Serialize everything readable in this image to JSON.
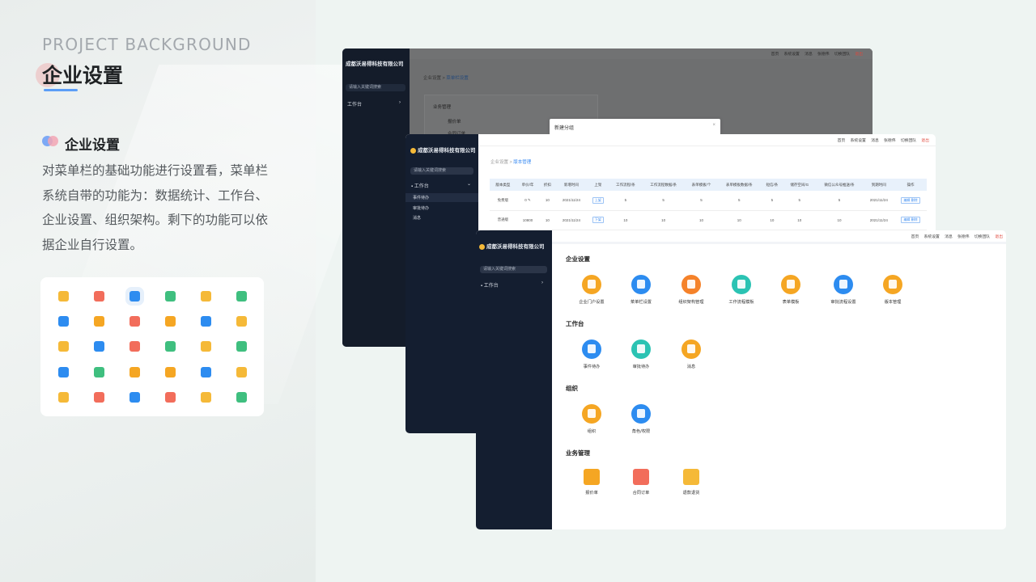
{
  "slide": {
    "kicker": "PROJECT  BACKGROUND",
    "title": "企业设置",
    "subtitle": "企业设置",
    "paragraph_lines": [
      "对菜单栏的基础功能进行设置看，菜单栏",
      "系统自带的功能为：数据统计、工作台、",
      "企业设置、组织架构。剩下的功能可以依",
      "据企业自行设置。"
    ]
  },
  "colors": {
    "accent_blue": "#3a8bf2",
    "underline": "#5b9ef7",
    "orange": "#f5a623",
    "blue": "#2d8cf0",
    "teal": "#2bc3b3",
    "salmon": "#f26d5b",
    "green": "#3fbf7f",
    "dark_sidebar": "#141e30",
    "logout_red": "#e0483c"
  },
  "icon_grid_colors": [
    [
      "#f5b938",
      "#f26d5b",
      "#2d8cf0",
      "#3fbf7f",
      "#f5b938",
      "#3fbf7f"
    ],
    [
      "#2d8cf0",
      "#f5a623",
      "#f26d5b",
      "#f5a623",
      "#2d8cf0",
      "#f5b938"
    ],
    [
      "#f5b938",
      "#2d8cf0",
      "#f26d5b",
      "#3fbf7f",
      "#f5b938",
      "#3fbf7f"
    ],
    [
      "#2d8cf0",
      "#3fbf7f",
      "#f5a623",
      "#f5a623",
      "#2d8cf0",
      "#f5b938"
    ],
    [
      "#f5b938",
      "#f26d5b",
      "#2d8cf0",
      "#f26d5b",
      "#f5b938",
      "#3fbf7f"
    ]
  ],
  "screen_back": {
    "company": "成都沃易得科技有限公司",
    "search_placeholder": "请输入关键词搜索",
    "nav": [
      "工作台"
    ],
    "top_links": [
      "首页",
      "系统设置",
      "消息",
      "张德伟",
      "切换团队",
      "退出"
    ],
    "breadcrumb": [
      "企业设置",
      "菜单栏设置"
    ],
    "tree_items": [
      "业务管理",
      "报价单",
      "合同订单"
    ],
    "dialog_title": "新建分组",
    "dialog_close": "×"
  },
  "screen_mid": {
    "company": "成都沃易得科技有限公司",
    "search_placeholder": "请输入关键词搜索",
    "nav": {
      "workspace": "工作台",
      "items": [
        "事件待办",
        "审批待办",
        "消息"
      ]
    },
    "top_links": [
      "首页",
      "系统设置",
      "消息",
      "张德伟",
      "切换团队",
      "退出"
    ],
    "breadcrumb": [
      "企业设置",
      "版本管理"
    ],
    "table": {
      "columns": [
        "版本类型",
        "单价/年",
        "折扣",
        "新增时间",
        "上架",
        "工作流程/条",
        "工作流程数据/条",
        "表单模板/个",
        "表单模板数据/条",
        "短信/条",
        "储存空间/G",
        "微信公众号推送/条",
        "到期时间",
        "操作"
      ],
      "rows": [
        [
          "免费版",
          "0 ✎",
          "10",
          "2021/11/24",
          "上架",
          "5",
          "5",
          "5",
          "5",
          "5",
          "5",
          "5",
          "2021/11/24",
          "编辑 删除"
        ],
        [
          "普通版",
          "10800",
          "10",
          "2021/11/24",
          "下架",
          "10",
          "10",
          "10",
          "10",
          "10",
          "10",
          "10",
          "2021/11/24",
          "编辑 删除"
        ]
      ]
    }
  },
  "screen_front": {
    "company": "成都沃易得科技有限公司",
    "search_placeholder": "请输入关键词搜索",
    "nav": [
      "工作台"
    ],
    "top_links": [
      "首页",
      "系统设置",
      "消息",
      "张德伟",
      "切换团队",
      "退出"
    ],
    "sections": [
      {
        "title": "企业设置",
        "apps": [
          {
            "label": "企业门户设置",
            "color": "#f5a623"
          },
          {
            "label": "菜单栏设置",
            "color": "#2d8cf0"
          },
          {
            "label": "组织架构管理",
            "color": "#f5822a"
          },
          {
            "label": "工作流程模板",
            "color": "#2bc3b3"
          },
          {
            "label": "表单模板",
            "color": "#f5a623"
          },
          {
            "label": "审批流程设置",
            "color": "#2d8cf0"
          },
          {
            "label": "版本管理",
            "color": "#f5a623"
          }
        ]
      },
      {
        "title": "工作台",
        "apps": [
          {
            "label": "事件待办",
            "color": "#2d8cf0"
          },
          {
            "label": "审批待办",
            "color": "#2bc3b3"
          },
          {
            "label": "消息",
            "color": "#f5a623"
          }
        ]
      },
      {
        "title": "组织",
        "apps": [
          {
            "label": "组织",
            "color": "#f5a623"
          },
          {
            "label": "角色/权限",
            "color": "#2d8cf0"
          }
        ]
      },
      {
        "title": "业务管理",
        "apps": [
          {
            "label": "报价单",
            "color": "#f5a623"
          },
          {
            "label": "合同订单",
            "color": "#f26d5b"
          },
          {
            "label": "退款退货",
            "color": "#f5b938"
          }
        ]
      }
    ]
  }
}
